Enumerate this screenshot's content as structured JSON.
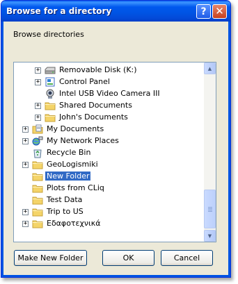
{
  "window": {
    "title": "Browse for a directory"
  },
  "description": "Browse directories",
  "tree": {
    "items": [
      {
        "label": "Removable Disk (K:)",
        "icon": "drive-icon",
        "expander": "+",
        "level": 2
      },
      {
        "label": "Control Panel",
        "icon": "control-panel-icon",
        "expander": "+",
        "level": 2
      },
      {
        "label": "Intel USB Video Camera III",
        "icon": "camera-icon",
        "expander": "",
        "level": 2
      },
      {
        "label": "Shared Documents",
        "icon": "folder-icon",
        "expander": "+",
        "level": 2
      },
      {
        "label": "John's Documents",
        "icon": "folder-icon",
        "expander": "+",
        "level": 2
      },
      {
        "label": "My Documents",
        "icon": "my-documents-icon",
        "expander": "+",
        "level": 1
      },
      {
        "label": "My Network Places",
        "icon": "network-places-icon",
        "expander": "+",
        "level": 1
      },
      {
        "label": "Recycle Bin",
        "icon": "recycle-bin-icon",
        "expander": "",
        "level": 1
      },
      {
        "label": "GeoLogismiki",
        "icon": "folder-icon",
        "expander": "+",
        "level": 1
      },
      {
        "label": "New Folder",
        "icon": "folder-icon",
        "expander": "",
        "level": 1,
        "selected": true
      },
      {
        "label": "Plots from CLiq",
        "icon": "folder-icon",
        "expander": "",
        "level": 1
      },
      {
        "label": "Test Data",
        "icon": "folder-icon",
        "expander": "",
        "level": 1
      },
      {
        "label": "Trip to US",
        "icon": "folder-icon",
        "expander": "+",
        "level": 1
      },
      {
        "label": "Εδαφοτεχνικά",
        "icon": "folder-icon",
        "expander": "+",
        "level": 1
      }
    ]
  },
  "buttons": {
    "new_folder": "Make New Folder",
    "ok": "OK",
    "cancel": "Cancel"
  },
  "colors": {
    "titlebar": "#0054e3",
    "selection": "#316ac5",
    "dialog_bg": "#ece9d8",
    "folder": "#f4d469"
  }
}
